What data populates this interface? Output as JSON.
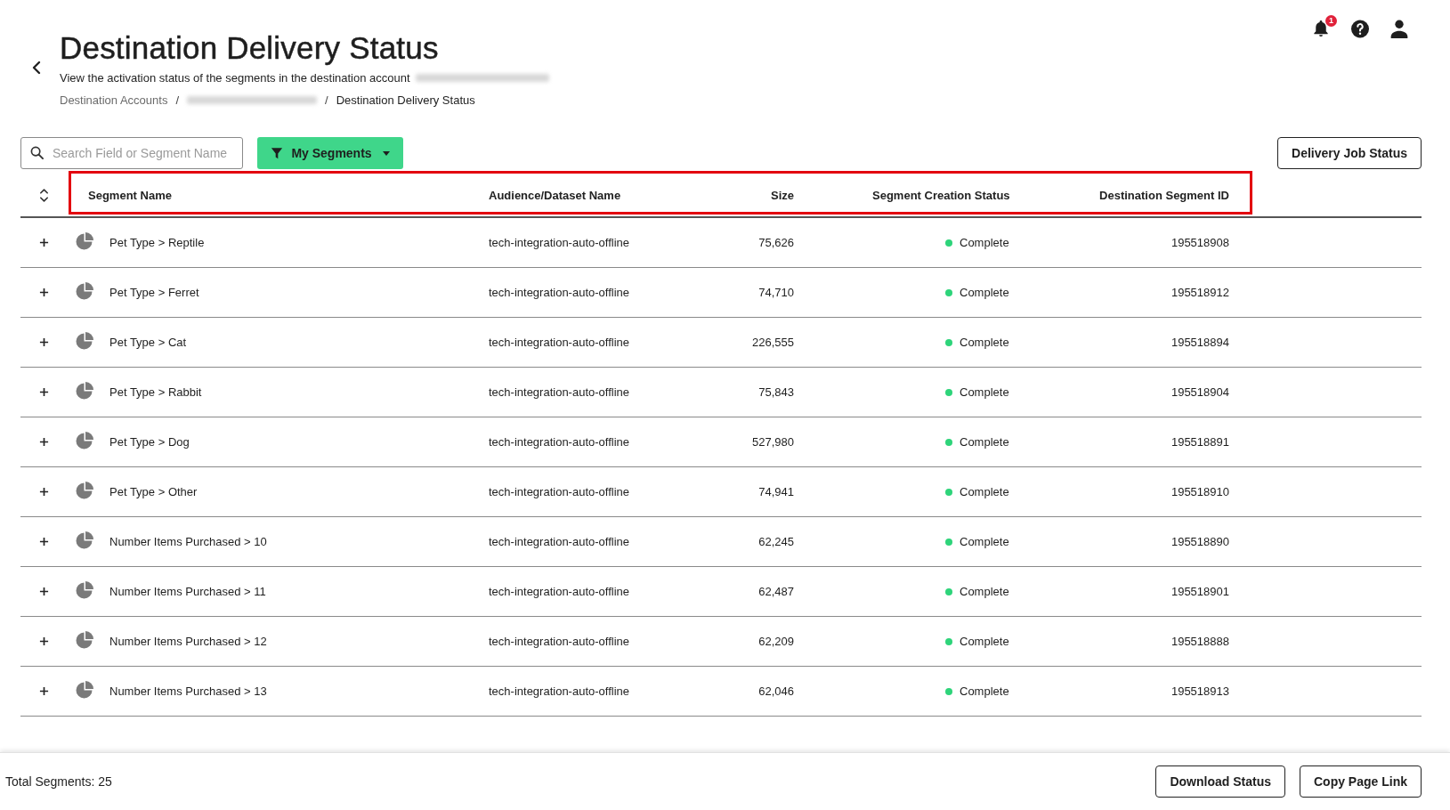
{
  "header": {
    "title": "Destination Delivery Status",
    "subtitle": "View the activation status of the segments in the destination account",
    "subtitle_redacted": true,
    "breadcrumb_separator": "/",
    "breadcrumb": [
      {
        "kind": "link",
        "label": "Destination Accounts"
      },
      {
        "kind": "redacted"
      },
      {
        "kind": "current",
        "label": "Destination Delivery Status"
      }
    ]
  },
  "top_bar": {
    "notification_count": "1"
  },
  "toolbar": {
    "search": {
      "placeholder": "Search Field or Segment Name"
    },
    "filter_button": "My Segments",
    "action_button": "Delivery Job Status"
  },
  "table": {
    "header_highlighted": true,
    "columns": [
      "Segment Name",
      "Audience/Dataset Name",
      "Size",
      "Segment Creation Status",
      "Destination Segment ID"
    ],
    "rows": [
      {
        "expanded": false,
        "name": "Pet Type > Reptile",
        "audience": "tech-integration-auto-offline",
        "size": "75,626",
        "status": "Complete",
        "color": "#2ed47a",
        "segment_id": "195518908"
      },
      {
        "expanded": false,
        "name": "Pet Type > Ferret",
        "audience": "tech-integration-auto-offline",
        "size": "74,710",
        "status": "Complete",
        "color": "#2ed47a",
        "segment_id": "195518912"
      },
      {
        "expanded": false,
        "name": "Pet Type > Cat",
        "audience": "tech-integration-auto-offline",
        "size": "226,555",
        "status": "Complete",
        "color": "#2ed47a",
        "segment_id": "195518894"
      },
      {
        "expanded": false,
        "name": "Pet Type > Rabbit",
        "audience": "tech-integration-auto-offline",
        "size": "75,843",
        "status": "Complete",
        "color": "#2ed47a",
        "segment_id": "195518904"
      },
      {
        "expanded": false,
        "name": "Pet Type > Dog",
        "audience": "tech-integration-auto-offline",
        "size": "527,980",
        "status": "Complete",
        "color": "#2ed47a",
        "segment_id": "195518891"
      },
      {
        "expanded": false,
        "name": "Pet Type > Other",
        "audience": "tech-integration-auto-offline",
        "size": "74,941",
        "status": "Complete",
        "color": "#2ed47a",
        "segment_id": "195518910"
      },
      {
        "expanded": false,
        "name": "Number Items Purchased > 10",
        "audience": "tech-integration-auto-offline",
        "size": "62,245",
        "status": "Complete",
        "color": "#2ed47a",
        "segment_id": "195518890"
      },
      {
        "expanded": false,
        "name": "Number Items Purchased > 11",
        "audience": "tech-integration-auto-offline",
        "size": "62,487",
        "status": "Complete",
        "color": "#2ed47a",
        "segment_id": "195518901"
      },
      {
        "expanded": false,
        "name": "Number Items Purchased > 12",
        "audience": "tech-integration-auto-offline",
        "size": "62,209",
        "status": "Complete",
        "color": "#2ed47a",
        "segment_id": "195518888"
      },
      {
        "expanded": false,
        "name": "Number Items Purchased > 13",
        "audience": "tech-integration-auto-offline",
        "size": "62,046",
        "status": "Complete",
        "color": "#2ed47a",
        "segment_id": "195518913"
      }
    ]
  },
  "footer": {
    "total": "Total Segments: 25",
    "buttons": [
      "Download Status",
      "Copy Page Link"
    ]
  }
}
